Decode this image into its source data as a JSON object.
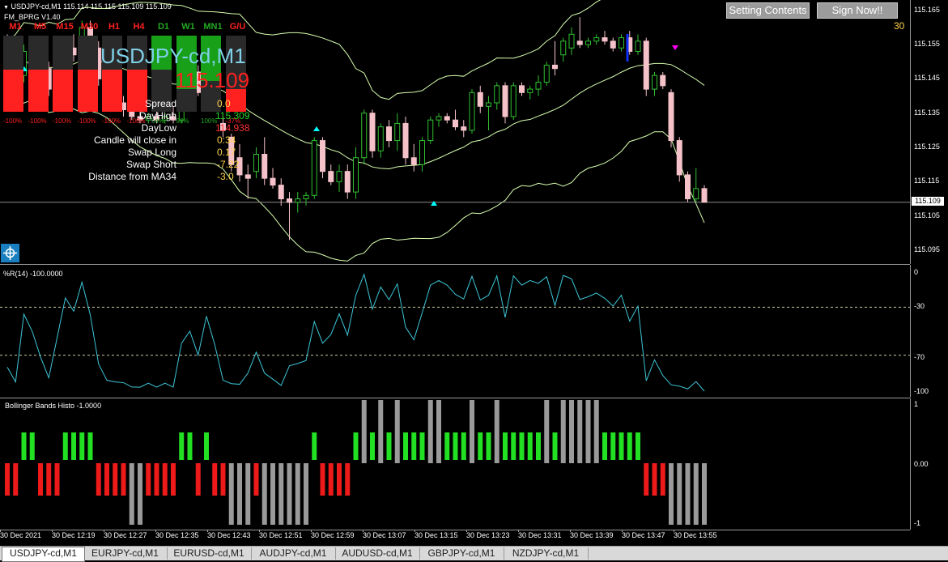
{
  "main_chart": {
    "header": "USDJPY-cd,M1  115.114 115.115 115.109 115.109",
    "indicator_name": "FM_BPRG V1.40",
    "symbol_title": "USDJPY-cd,M1",
    "big_price": "115.109",
    "number_30": "30",
    "current_price": "115.109",
    "price_ticks": [
      "115.165",
      "115.155",
      "115.145",
      "115.135",
      "115.125",
      "115.115",
      "115.105",
      "115.095"
    ],
    "price_range": [
      115.091,
      115.168
    ],
    "timeframes": [
      {
        "label": "M1",
        "color": "#ff2020",
        "fill": 0.55,
        "fill_color": "#ff2020",
        "pct": "-100%"
      },
      {
        "label": "M5",
        "color": "#ff2020",
        "fill": 0.55,
        "fill_color": "#ff2020",
        "pct": "-100%"
      },
      {
        "label": "M15",
        "color": "#ff2020",
        "fill": 0.55,
        "fill_color": "#ff2020",
        "pct": "-100%"
      },
      {
        "label": "M30",
        "color": "#ff2020",
        "fill": 0.55,
        "fill_color": "#ff2020",
        "pct": "-100%"
      },
      {
        "label": "H1",
        "color": "#ff2020",
        "fill": 0.55,
        "fill_color": "#ff2020",
        "pct": "-100%"
      },
      {
        "label": "H4",
        "color": "#ff2020",
        "fill": 0.55,
        "fill_color": "#ff2020",
        "pct": "-100%"
      },
      {
        "label": "D1",
        "color": "#22aa22",
        "fill": 0.45,
        "fill_color": "#18a018",
        "pct": "54%"
      },
      {
        "label": "W1",
        "color": "#22aa22",
        "fill": 0.7,
        "fill_color": "#18a018",
        "pct": "90%"
      },
      {
        "label": "MN1",
        "color": "#22aa22",
        "fill": 0.6,
        "fill_color": "#18a018",
        "pct": "100%"
      },
      {
        "label": "G/U",
        "color": "#ff2020",
        "fill": 0.3,
        "fill_color": "#ff2020",
        "pct": "-37%"
      }
    ],
    "info": [
      {
        "label": "Spread",
        "value": "0.0",
        "color": "#ffd24a"
      },
      {
        "label": "DayHigh",
        "value": "115.309",
        "color": "#28d028"
      },
      {
        "label": "DayLow",
        "value": "114.938",
        "color": "#ff3030"
      },
      {
        "label": "Candle will close in",
        "value": "0:34",
        "color": "#ffd24a"
      },
      {
        "label": "Swap Long",
        "value": "0.17",
        "color": "#ffd24a"
      },
      {
        "label": "Swap Short",
        "value": "-7.22",
        "color": "#ffd24a"
      },
      {
        "label": "Distance from MA34",
        "value": "-3.0",
        "color": "#ffd24a"
      }
    ],
    "buttons": {
      "setting": "Setting Contents",
      "signup": "Sign Now!!"
    }
  },
  "wpr": {
    "title": "%R(14) -100.0000",
    "ticks": [
      "0",
      "-30",
      "-70",
      "-100"
    ],
    "color": "#3ec6d8"
  },
  "bb_histo": {
    "title": "Bollinger Bands Histo -1.0000",
    "ticks": [
      "1",
      "0.00",
      "-1"
    ]
  },
  "x_axis": [
    "30 Dec 2021",
    "30 Dec 12:19",
    "30 Dec 12:27",
    "30 Dec 12:35",
    "30 Dec 12:43",
    "30 Dec 12:51",
    "30 Dec 12:59",
    "30 Dec 13:07",
    "30 Dec 13:15",
    "30 Dec 13:23",
    "30 Dec 13:31",
    "30 Dec 13:39",
    "30 Dec 13:47",
    "30 Dec 13:55"
  ],
  "tabs": [
    "USDJPY-cd,M1",
    "EURJPY-cd,M1",
    "EURUSD-cd,M1",
    "AUDJPY-cd,M1",
    "AUDUSD-cd,M1",
    "GBPJPY-cd,M1",
    "NZDJPY-cd,M1"
  ],
  "chart_data": {
    "type": "candlestick",
    "symbol": "USDJPY-cd",
    "timeframe": "M1",
    "candles": [
      {
        "o": 115.153,
        "h": 115.158,
        "l": 115.148,
        "c": 115.15
      },
      {
        "o": 115.15,
        "h": 115.152,
        "l": 115.145,
        "c": 115.146
      },
      {
        "o": 115.146,
        "h": 115.155,
        "l": 115.144,
        "c": 115.153
      },
      {
        "o": 115.153,
        "h": 115.156,
        "l": 115.15,
        "c": 115.151
      },
      {
        "o": 115.151,
        "h": 115.153,
        "l": 115.147,
        "c": 115.148
      },
      {
        "o": 115.148,
        "h": 115.15,
        "l": 115.14,
        "c": 115.142
      },
      {
        "o": 115.142,
        "h": 115.15,
        "l": 115.14,
        "c": 115.148
      },
      {
        "o": 115.148,
        "h": 115.156,
        "l": 115.146,
        "c": 115.154
      },
      {
        "o": 115.154,
        "h": 115.158,
        "l": 115.15,
        "c": 115.152
      },
      {
        "o": 115.152,
        "h": 115.162,
        "l": 115.15,
        "c": 115.16
      },
      {
        "o": 115.16,
        "h": 115.162,
        "l": 115.152,
        "c": 115.154
      },
      {
        "o": 115.154,
        "h": 115.156,
        "l": 115.143,
        "c": 115.145
      },
      {
        "o": 115.145,
        "h": 115.15,
        "l": 115.14,
        "c": 115.142
      },
      {
        "o": 115.142,
        "h": 115.144,
        "l": 115.136,
        "c": 115.138
      },
      {
        "o": 115.138,
        "h": 115.14,
        "l": 115.134,
        "c": 115.136
      },
      {
        "o": 115.136,
        "h": 115.138,
        "l": 115.133,
        "c": 115.134
      },
      {
        "o": 115.134,
        "h": 115.136,
        "l": 115.132,
        "c": 115.133
      },
      {
        "o": 115.133,
        "h": 115.135,
        "l": 115.132,
        "c": 115.134
      },
      {
        "o": 115.134,
        "h": 115.136,
        "l": 115.132,
        "c": 115.133
      },
      {
        "o": 115.133,
        "h": 115.135,
        "l": 115.132,
        "c": 115.134
      },
      {
        "o": 115.134,
        "h": 115.137,
        "l": 115.132,
        "c": 115.133
      },
      {
        "o": 115.133,
        "h": 115.145,
        "l": 115.132,
        "c": 115.144
      },
      {
        "o": 115.144,
        "h": 115.15,
        "l": 115.14,
        "c": 115.147
      },
      {
        "o": 115.147,
        "h": 115.149,
        "l": 115.14,
        "c": 115.141
      },
      {
        "o": 115.141,
        "h": 115.148,
        "l": 115.14,
        "c": 115.147
      },
      {
        "o": 115.147,
        "h": 115.148,
        "l": 115.138,
        "c": 115.139
      },
      {
        "o": 115.132,
        "h": 115.134,
        "l": 115.128,
        "c": 115.13
      },
      {
        "o": 115.128,
        "h": 115.129,
        "l": 115.118,
        "c": 115.12
      },
      {
        "o": 115.122,
        "h": 115.126,
        "l": 115.115,
        "c": 115.117
      },
      {
        "o": 115.117,
        "h": 115.12,
        "l": 115.11,
        "c": 115.116
      },
      {
        "o": 115.118,
        "h": 115.125,
        "l": 115.116,
        "c": 115.123
      },
      {
        "o": 115.123,
        "h": 115.128,
        "l": 115.114,
        "c": 115.116
      },
      {
        "o": 115.116,
        "h": 115.119,
        "l": 115.113,
        "c": 115.114
      },
      {
        "o": 115.114,
        "h": 115.116,
        "l": 115.108,
        "c": 115.11
      },
      {
        "o": 115.11,
        "h": 115.112,
        "l": 115.098,
        "c": 115.109
      },
      {
        "o": 115.109,
        "h": 115.112,
        "l": 115.106,
        "c": 115.11
      },
      {
        "o": 115.11,
        "h": 115.112,
        "l": 115.108,
        "c": 115.111
      },
      {
        "o": 115.111,
        "h": 115.128,
        "l": 115.11,
        "c": 115.127
      },
      {
        "o": 115.127,
        "h": 115.128,
        "l": 115.116,
        "c": 115.118
      },
      {
        "o": 115.118,
        "h": 115.12,
        "l": 115.114,
        "c": 115.115
      },
      {
        "o": 115.115,
        "h": 115.12,
        "l": 115.112,
        "c": 115.118
      },
      {
        "o": 115.118,
        "h": 115.12,
        "l": 115.11,
        "c": 115.112
      },
      {
        "o": 115.112,
        "h": 115.125,
        "l": 115.11,
        "c": 115.122
      },
      {
        "o": 115.122,
        "h": 115.136,
        "l": 115.12,
        "c": 115.135
      },
      {
        "o": 115.135,
        "h": 115.136,
        "l": 115.122,
        "c": 115.124
      },
      {
        "o": 115.124,
        "h": 115.132,
        "l": 115.122,
        "c": 115.131
      },
      {
        "o": 115.131,
        "h": 115.133,
        "l": 115.125,
        "c": 115.127
      },
      {
        "o": 115.127,
        "h": 115.135,
        "l": 115.124,
        "c": 115.132
      },
      {
        "o": 115.132,
        "h": 115.134,
        "l": 115.12,
        "c": 115.122
      },
      {
        "o": 115.122,
        "h": 115.126,
        "l": 115.118,
        "c": 115.12
      },
      {
        "o": 115.12,
        "h": 115.128,
        "l": 115.118,
        "c": 115.127
      },
      {
        "o": 115.127,
        "h": 115.134,
        "l": 115.126,
        "c": 115.133
      },
      {
        "o": 115.133,
        "h": 115.135,
        "l": 115.131,
        "c": 115.134
      },
      {
        "o": 115.134,
        "h": 115.135,
        "l": 115.132,
        "c": 115.133
      },
      {
        "o": 115.133,
        "h": 115.136,
        "l": 115.13,
        "c": 115.131
      },
      {
        "o": 115.131,
        "h": 115.133,
        "l": 115.128,
        "c": 115.13
      },
      {
        "o": 115.13,
        "h": 115.142,
        "l": 115.129,
        "c": 115.141
      },
      {
        "o": 115.141,
        "h": 115.143,
        "l": 115.135,
        "c": 115.137
      },
      {
        "o": 115.137,
        "h": 115.14,
        "l": 115.13,
        "c": 115.138
      },
      {
        "o": 115.138,
        "h": 115.144,
        "l": 115.136,
        "c": 115.143
      },
      {
        "o": 115.143,
        "h": 115.144,
        "l": 115.132,
        "c": 115.134
      },
      {
        "o": 115.134,
        "h": 115.144,
        "l": 115.133,
        "c": 115.143
      },
      {
        "o": 115.143,
        "h": 115.144,
        "l": 115.14,
        "c": 115.141
      },
      {
        "o": 115.141,
        "h": 115.143,
        "l": 115.139,
        "c": 115.142
      },
      {
        "o": 115.142,
        "h": 115.146,
        "l": 115.14,
        "c": 115.144
      },
      {
        "o": 115.144,
        "h": 115.15,
        "l": 115.143,
        "c": 115.149
      },
      {
        "o": 115.149,
        "h": 115.156,
        "l": 115.146,
        "c": 115.148
      },
      {
        "o": 115.152,
        "h": 115.157,
        "l": 115.15,
        "c": 115.156
      },
      {
        "o": 115.154,
        "h": 115.16,
        "l": 115.152,
        "c": 115.158
      },
      {
        "o": 115.156,
        "h": 115.163,
        "l": 115.154,
        "c": 115.155
      },
      {
        "o": 115.155,
        "h": 115.157,
        "l": 115.154,
        "c": 115.156
      },
      {
        "o": 115.156,
        "h": 115.158,
        "l": 115.155,
        "c": 115.157
      },
      {
        "o": 115.157,
        "h": 115.159,
        "l": 115.155,
        "c": 115.156
      },
      {
        "o": 115.156,
        "h": 115.157,
        "l": 115.153,
        "c": 115.154
      },
      {
        "o": 115.154,
        "h": 115.158,
        "l": 115.153,
        "c": 115.157
      },
      {
        "o": 115.157,
        "h": 115.159,
        "l": 115.152,
        "c": 115.153
      },
      {
        "o": 115.153,
        "h": 115.158,
        "l": 115.152,
        "c": 115.156
      },
      {
        "o": 115.156,
        "h": 115.157,
        "l": 115.14,
        "c": 115.142
      },
      {
        "o": 115.142,
        "h": 115.147,
        "l": 115.14,
        "c": 115.146
      },
      {
        "o": 115.146,
        "h": 115.147,
        "l": 115.142,
        "c": 115.143
      },
      {
        "o": 115.141,
        "h": 115.142,
        "l": 115.125,
        "c": 115.127
      },
      {
        "o": 115.127,
        "h": 115.128,
        "l": 115.115,
        "c": 115.117
      },
      {
        "o": 115.117,
        "h": 115.118,
        "l": 115.109,
        "c": 115.11
      },
      {
        "o": 115.11,
        "h": 115.119,
        "l": 115.109,
        "c": 115.113
      },
      {
        "o": 115.113,
        "h": 115.114,
        "l": 115.109,
        "c": 115.109
      }
    ]
  }
}
